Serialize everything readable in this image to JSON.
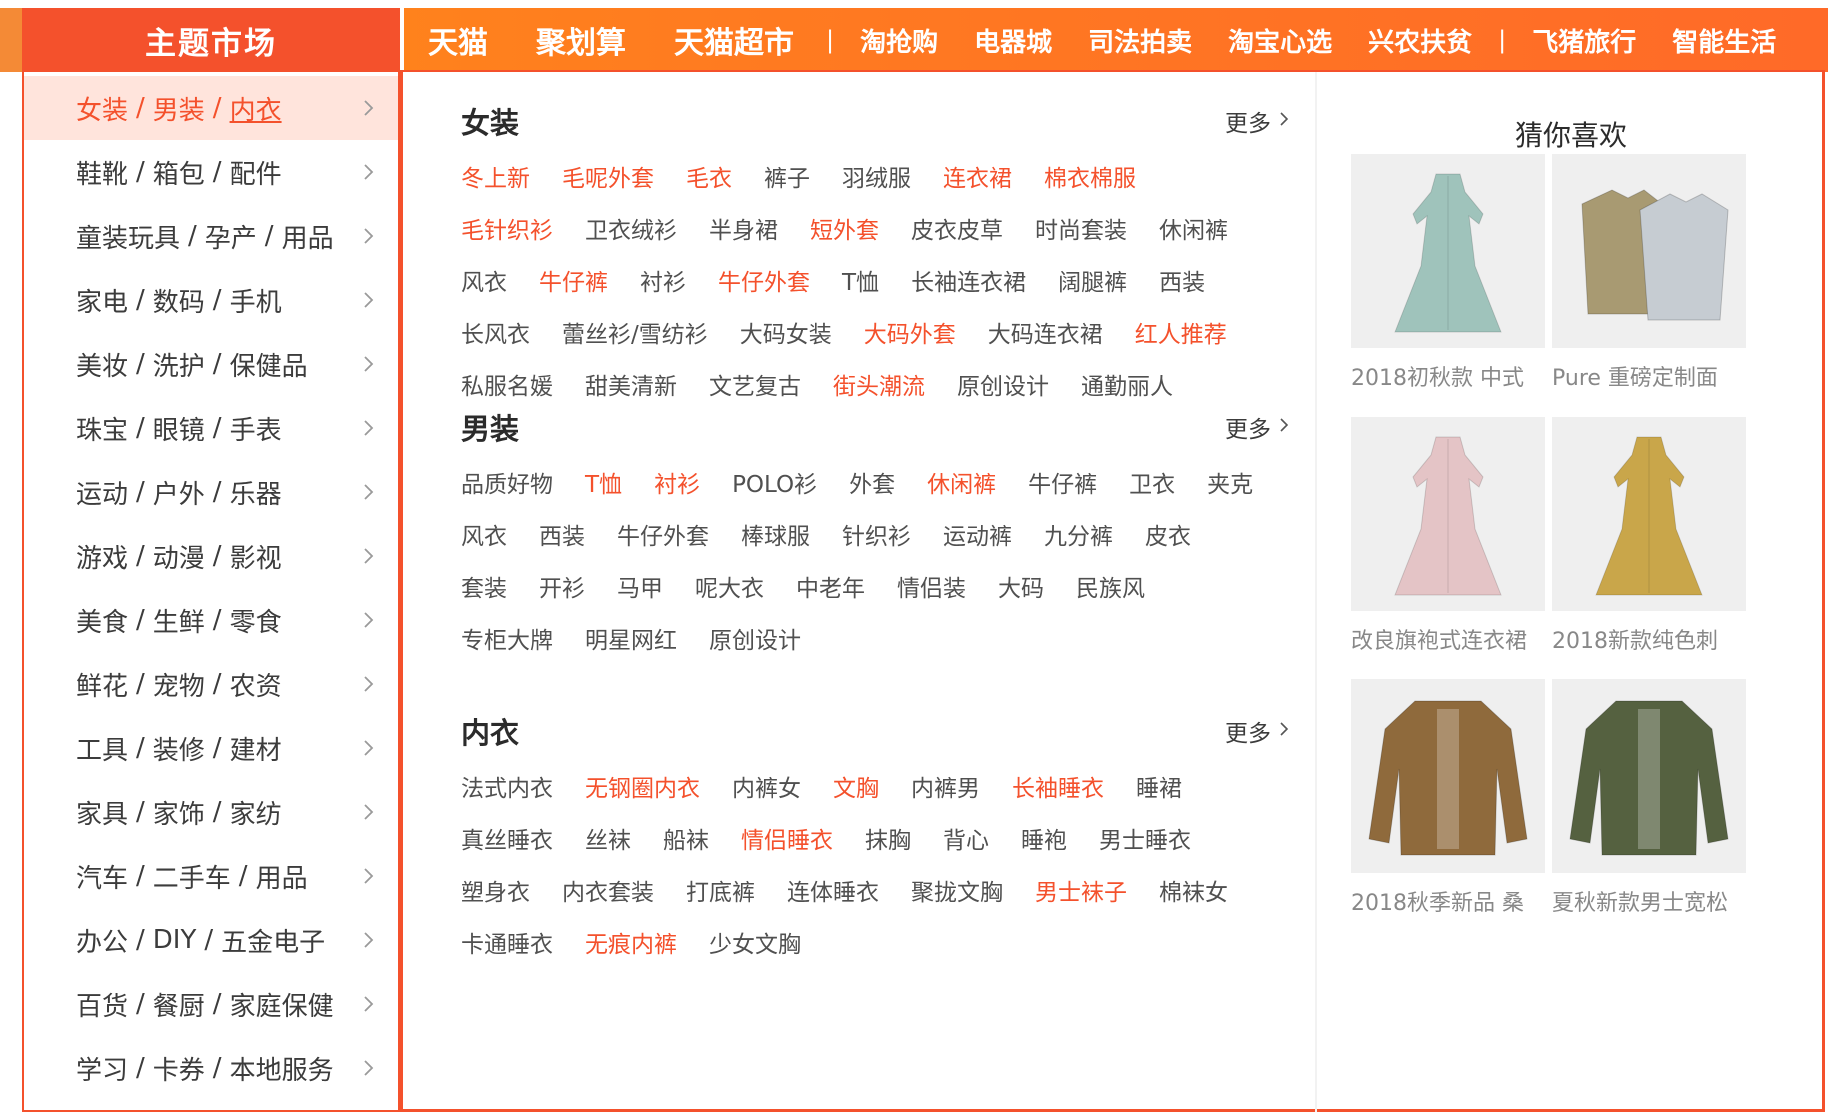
{
  "nav": {
    "market_title": "主题市场",
    "items_big": [
      "天猫",
      "聚划算",
      "天猫超市"
    ],
    "separator": "|",
    "items_small_a": [
      "淘抢购",
      "电器城",
      "司法拍卖",
      "淘宝心选",
      "兴农扶贫"
    ],
    "items_small_b": [
      "飞猪旅行",
      "智能生活"
    ]
  },
  "categories": [
    {
      "parts": [
        "女装",
        "男装",
        "内衣"
      ],
      "active": true
    },
    {
      "parts": [
        "鞋靴",
        "箱包",
        "配件"
      ]
    },
    {
      "parts": [
        "童装玩具",
        "孕产",
        "用品"
      ]
    },
    {
      "parts": [
        "家电",
        "数码",
        "手机"
      ]
    },
    {
      "parts": [
        "美妆",
        "洗护",
        "保健品"
      ]
    },
    {
      "parts": [
        "珠宝",
        "眼镜",
        "手表"
      ]
    },
    {
      "parts": [
        "运动",
        "户外",
        "乐器"
      ]
    },
    {
      "parts": [
        "游戏",
        "动漫",
        "影视"
      ]
    },
    {
      "parts": [
        "美食",
        "生鲜",
        "零食"
      ]
    },
    {
      "parts": [
        "鲜花",
        "宠物",
        "农资"
      ]
    },
    {
      "parts": [
        "工具",
        "装修",
        "建材"
      ]
    },
    {
      "parts": [
        "家具",
        "家饰",
        "家纺"
      ]
    },
    {
      "parts": [
        "汽车",
        "二手车",
        "用品"
      ]
    },
    {
      "parts": [
        "办公",
        "DIY",
        "五金电子"
      ]
    },
    {
      "parts": [
        "百货",
        "餐厨",
        "家庭保健"
      ]
    },
    {
      "parts": [
        "学习",
        "卡券",
        "本地服务"
      ]
    }
  ],
  "sections": [
    {
      "title": "女装",
      "more": "更多",
      "tags": [
        {
          "t": "冬上新",
          "hot": true
        },
        {
          "t": "毛呢外套",
          "hot": true
        },
        {
          "t": "毛衣",
          "hot": true
        },
        {
          "t": "裤子"
        },
        {
          "t": "羽绒服"
        },
        {
          "t": "连衣裙",
          "hot": true
        },
        {
          "t": "棉衣棉服",
          "hot": true
        },
        {
          "t": "毛针织衫",
          "hot": true
        },
        {
          "t": "卫衣绒衫"
        },
        {
          "t": "半身裙"
        },
        {
          "t": "短外套",
          "hot": true
        },
        {
          "t": "皮衣皮草"
        },
        {
          "t": "时尚套装"
        },
        {
          "t": "休闲裤"
        },
        {
          "t": "风衣"
        },
        {
          "t": "牛仔裤",
          "hot": true
        },
        {
          "t": "衬衫"
        },
        {
          "t": "牛仔外套",
          "hot": true
        },
        {
          "t": "T恤"
        },
        {
          "t": "长袖连衣裙"
        },
        {
          "t": "阔腿裤"
        },
        {
          "t": "西装"
        },
        {
          "t": "长风衣"
        },
        {
          "t": "蕾丝衫/雪纺衫"
        },
        {
          "t": "大码女装"
        },
        {
          "t": "大码外套",
          "hot": true
        },
        {
          "t": "大码连衣裙"
        },
        {
          "t": "红人推荐",
          "hot": true
        },
        {
          "t": "私服名媛"
        },
        {
          "t": "甜美清新"
        },
        {
          "t": "文艺复古"
        },
        {
          "t": "街头潮流",
          "hot": true
        },
        {
          "t": "原创设计"
        },
        {
          "t": "通勤丽人"
        }
      ]
    },
    {
      "title": "男装",
      "more": "更多",
      "tags": [
        {
          "t": "品质好物"
        },
        {
          "t": "T恤",
          "hot": true
        },
        {
          "t": "衬衫",
          "hot": true
        },
        {
          "t": "POLO衫"
        },
        {
          "t": "外套"
        },
        {
          "t": "休闲裤",
          "hot": true
        },
        {
          "t": "牛仔裤"
        },
        {
          "t": "卫衣"
        },
        {
          "t": "夹克"
        },
        {
          "t": "风衣"
        },
        {
          "t": "西装"
        },
        {
          "t": "牛仔外套"
        },
        {
          "t": "棒球服"
        },
        {
          "t": "针织衫"
        },
        {
          "t": "运动裤"
        },
        {
          "t": "九分裤"
        },
        {
          "t": "皮衣"
        },
        {
          "t": "套装"
        },
        {
          "t": "开衫"
        },
        {
          "t": "马甲"
        },
        {
          "t": "呢大衣"
        },
        {
          "t": "中老年"
        },
        {
          "t": "情侣装"
        },
        {
          "t": "大码"
        },
        {
          "t": "民族风"
        },
        {
          "t": "专柜大牌"
        },
        {
          "t": "明星网红"
        },
        {
          "t": "原创设计"
        }
      ]
    },
    {
      "title": "内衣",
      "more": "更多",
      "tags": [
        {
          "t": "法式内衣"
        },
        {
          "t": "无钢圈内衣",
          "hot": true
        },
        {
          "t": "内裤女"
        },
        {
          "t": "文胸",
          "hot": true
        },
        {
          "t": "内裤男"
        },
        {
          "t": "长袖睡衣",
          "hot": true
        },
        {
          "t": "睡裙"
        },
        {
          "t": "真丝睡衣"
        },
        {
          "t": "丝袜"
        },
        {
          "t": "船袜"
        },
        {
          "t": "情侣睡衣",
          "hot": true
        },
        {
          "t": "抹胸"
        },
        {
          "t": "背心"
        },
        {
          "t": "睡袍"
        },
        {
          "t": "男士睡衣"
        },
        {
          "t": "塑身衣"
        },
        {
          "t": "内衣套装"
        },
        {
          "t": "打底裤"
        },
        {
          "t": "连体睡衣"
        },
        {
          "t": "聚拢文胸"
        },
        {
          "t": "男士袜子",
          "hot": true
        },
        {
          "t": "棉袜女"
        },
        {
          "t": "卡通睡衣"
        },
        {
          "t": "无痕内裤",
          "hot": true
        },
        {
          "t": "少女文胸"
        }
      ]
    }
  ],
  "recs": {
    "title": "猜你喜欢",
    "items": [
      {
        "caption": "2018初秋款 中式",
        "icon": "dress-icon",
        "color": "#9fc3bb"
      },
      {
        "caption": "Pure 重磅定制面",
        "icon": "shirts-icon",
        "color": "#a89a72"
      },
      {
        "caption": "改良旗袍式连衣裙",
        "icon": "dress-icon",
        "color": "#e4c4c6"
      },
      {
        "caption": "2018新款纯色刺",
        "icon": "dress-icon",
        "color": "#c9a64a"
      },
      {
        "caption": "2018秋季新品 桑",
        "icon": "jacket-icon",
        "color": "#8f6a3c"
      },
      {
        "caption": "夏秋新款男士宽松",
        "icon": "jacket-icon",
        "color": "#556140"
      }
    ]
  }
}
